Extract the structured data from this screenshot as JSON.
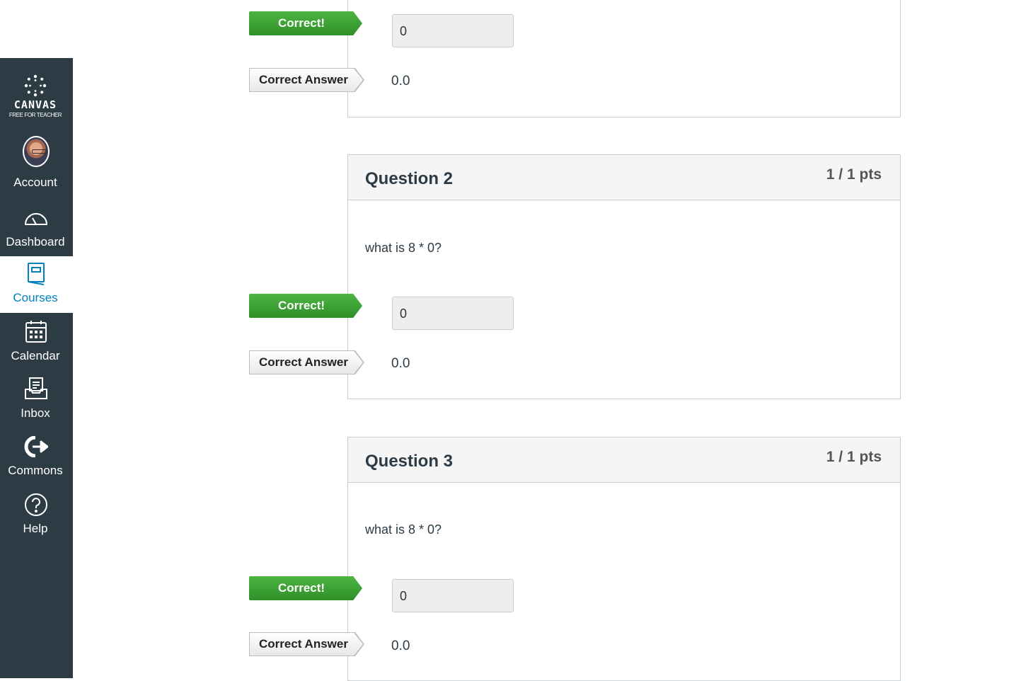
{
  "nav": {
    "logo_text": "CANVAS",
    "logo_sub": "FREE FOR TEACHER",
    "items": [
      {
        "label": "Account",
        "icon": "avatar"
      },
      {
        "label": "Dashboard",
        "icon": "dashboard-icon"
      },
      {
        "label": "Courses",
        "icon": "courses-icon",
        "active": true
      },
      {
        "label": "Calendar",
        "icon": "calendar-icon"
      },
      {
        "label": "Inbox",
        "icon": "inbox-icon"
      },
      {
        "label": "Commons",
        "icon": "commons-icon"
      },
      {
        "label": "Help",
        "icon": "help-icon"
      }
    ]
  },
  "flags": {
    "correct": "Correct!",
    "correct_answer": "Correct Answer"
  },
  "questions": [
    {
      "answer": "0",
      "correct_answer": "0.0"
    },
    {
      "title": "Question 2",
      "points": "1 / 1 pts",
      "text": "what is 8 * 0?",
      "answer": "0",
      "correct_answer": "0.0"
    },
    {
      "title": "Question 3",
      "points": "1 / 1 pts",
      "text": "what is 8 * 0?",
      "answer": "0",
      "correct_answer": "0.0"
    }
  ],
  "colors": {
    "nav_bg": "#2d3b45",
    "active": "#0081bd",
    "correct_flag": "#3ea337"
  }
}
